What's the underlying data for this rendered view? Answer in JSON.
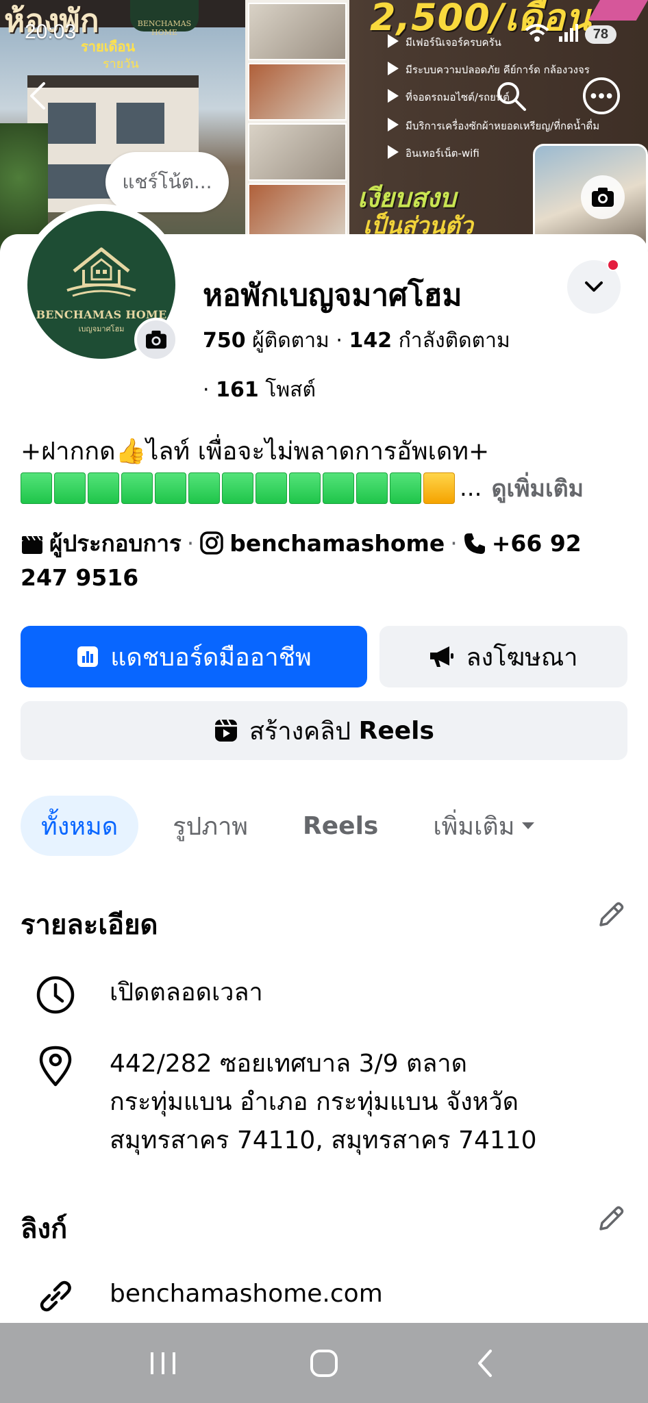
{
  "status_bar": {
    "time": "20:03",
    "battery": "78"
  },
  "cover": {
    "title": "ห้องพัก",
    "sub1": "รายเดือน",
    "sub2": "รายวัน",
    "logo_text": "BENCHAMAS HOME",
    "price": "2,500/เดือน",
    "features": [
      "มีเฟอร์นิเจอร์ครบครัน",
      "มีระบบความปลอดภัย คีย์การ์ด กล้องวงจร",
      "ที่จอดรถมอไซต์/รถยนต์",
      "มีบริการเครื่องซักผ้าหยอดเหรียญ/ที่กดน้ำดื่ม",
      "อินเทอร์เน็ต-wifi"
    ],
    "slogan1": "เงียบสงบ",
    "slogan2": "เป็นส่วนตัว"
  },
  "note": {
    "placeholder": "แชร์โน้ต..."
  },
  "avatar": {
    "brand": "BENCHAMAS HOME",
    "brand_th": "เบญจมาศโฮม"
  },
  "profile": {
    "name": "หอพักเบญจมาศโฮม",
    "followers_count": "750",
    "followers_label": "ผู้ติดตาม",
    "following_count": "142",
    "following_label": "กำลังติดตาม",
    "posts_count": "161",
    "posts_label": "โพสต์"
  },
  "bio": {
    "line1": "+ฝากกด👍ไลท์ เพื่อจะไม่พลาดการอัพเดท+",
    "progress_total": 13,
    "progress_filled": 12,
    "ellipsis": "...",
    "see_more": "ดูเพิ่มเติม"
  },
  "info": {
    "category": "ผู้ประกอบการ",
    "instagram": "benchamashome",
    "phone": "+66 92 247 9516"
  },
  "buttons": {
    "professional_dashboard": "แดชบอร์ดมืออาชีพ",
    "advertise": "ลงโฆษณา",
    "create_reels_prefix": "สร้างคลิป",
    "create_reels_bold": "Reels"
  },
  "tabs": [
    {
      "label": "ทั้งหมด"
    },
    {
      "label": "รูปภาพ"
    },
    {
      "label": "Reels"
    },
    {
      "label": "เพิ่มเติม"
    }
  ],
  "details": {
    "title": "รายละเอียด",
    "hours": "เปิดตลอดเวลา",
    "address_line1": "442/282 ซอยเทศบาล 3/9 ตลาด",
    "address_line2": "กระทุ่มแบน อำเภอ กระทุ่มแบน จังหวัด",
    "address_line3": "สมุทรสาคร 74110, สมุทรสาคร 74110"
  },
  "links": {
    "title": "ลิงก์",
    "website": "benchamashome.com"
  },
  "colors": {
    "primary": "#0866ff",
    "secondary_bg": "#f0f2f5",
    "text": "#050505",
    "muted": "#65676b",
    "active_tab_bg": "#e7f3ff",
    "notification": "#e41e3f",
    "avatar_bg": "#1e4d34"
  }
}
